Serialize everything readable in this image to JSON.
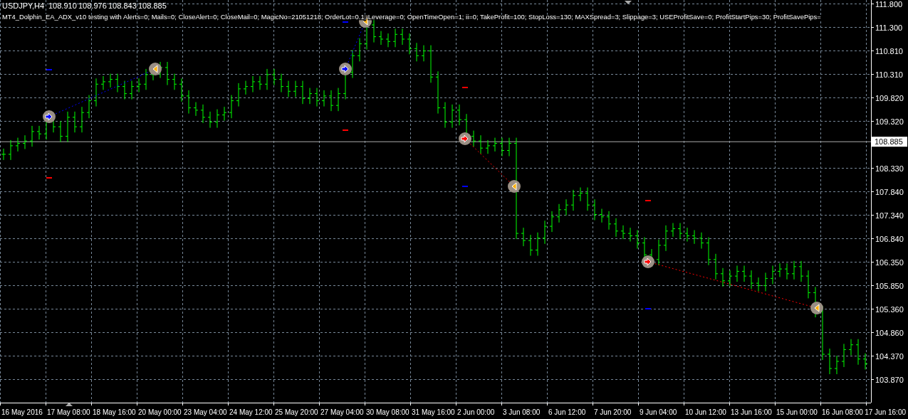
{
  "chart": {
    "symbol": "USDJPY,H4",
    "ohlc": [
      "108.910",
      "108.976",
      "108.843",
      "108.885"
    ],
    "expert_line": "MT4_Dolphin_EA_ADX_v10 testing with Alerts=0; Mails=0; CloseAlert=0; CloseMail=0; MagicNo=21051218; OrderLot=0.1; Leverage=0; OpenTimeOpen=1; ii=0; TakeProfit=100; StopLoss=130; MAXSpread=3; Slippage=3; USEProfitSave=0; ProfitStartPips=30; ProfitSavePips=",
    "current_price": "108.885",
    "price_axis": [
      "111.800",
      "111.300",
      "110.810",
      "110.310",
      "109.820",
      "109.320",
      "108.330",
      "107.840",
      "107.340",
      "106.840",
      "106.350",
      "105.850",
      "105.360",
      "104.860",
      "104.370",
      "103.870"
    ],
    "time_axis": [
      "16 May 2016",
      "17 May 08:00",
      "18 May 16:00",
      "20 May 00:00",
      "23 May 04:00",
      "24 May 12:00",
      "25 May 20:00",
      "27 May 04:00",
      "30 May 08:00",
      "31 May 16:00",
      "2 Jun 00:00",
      "3 Jun 08:00",
      "6 Jun 12:00",
      "7 Jun 20:00",
      "9 Jun 04:00",
      "10 Jun 12:00",
      "13 Jun 16:00",
      "15 Jun 00:00",
      "16 Jun 08:00",
      "17 Jun 16:00"
    ],
    "trades": [
      {
        "kind": "buy"
      },
      {
        "kind": "buy"
      },
      {
        "kind": "sell"
      },
      {
        "kind": "sell"
      }
    ]
  }
}
